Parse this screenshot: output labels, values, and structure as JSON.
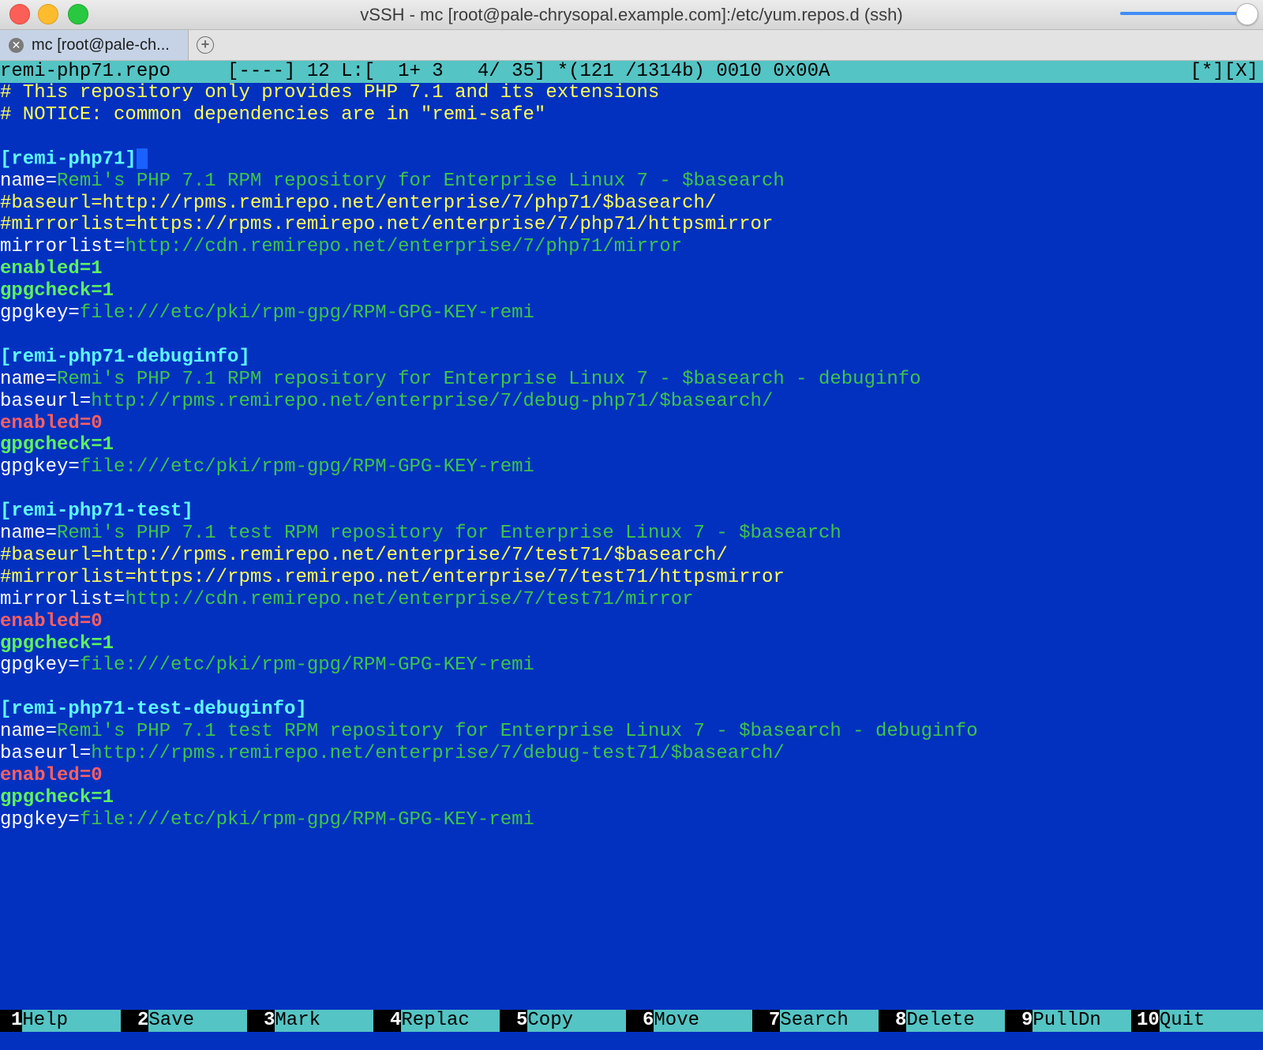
{
  "window": {
    "title": "vSSH - mc [root@pale-chrysopal.example.com]:/etc/yum.repos.d (ssh)"
  },
  "tab": {
    "label": "mc [root@pale-ch...",
    "close_glyph": "✕",
    "new_tab_glyph": "+"
  },
  "editor": {
    "status": "remi-php71.repo     [----] 12 L:[  1+ 3   4/ 35] *(121 /1314b) 0010 0x00A",
    "flags": "[*][X]",
    "lines": [
      {
        "key": "# This repository only provides PHP 7.1 and its extensions",
        "val": ""
      },
      {
        "key": "# NOTICE: common dependencies are in \"remi-safe\"",
        "val": ""
      },
      {
        "key": "",
        "val": ""
      },
      {
        "key": "[remi-php71]",
        "val": ""
      },
      {
        "key": "name=",
        "val": "Remi's PHP 7.1 RPM repository for Enterprise Linux 7 - $basearch"
      },
      {
        "key": "#baseurl=http://rpms.remirepo.net/enterprise/7/php71/$basearch/",
        "val": ""
      },
      {
        "key": "#mirrorlist=https://rpms.remirepo.net/enterprise/7/php71/httpsmirror",
        "val": ""
      },
      {
        "key": "mirrorlist=",
        "val": "http://cdn.remirepo.net/enterprise/7/php71/mirror"
      },
      {
        "key": "enabled=1",
        "val": ""
      },
      {
        "key": "gpgcheck=1",
        "val": ""
      },
      {
        "key": "gpgkey=",
        "val": "file:///etc/pki/rpm-gpg/RPM-GPG-KEY-remi"
      },
      {
        "key": "",
        "val": ""
      },
      {
        "key": "[remi-php71-debuginfo]",
        "val": ""
      },
      {
        "key": "name=",
        "val": "Remi's PHP 7.1 RPM repository for Enterprise Linux 7 - $basearch - debuginfo"
      },
      {
        "key": "baseurl=",
        "val": "http://rpms.remirepo.net/enterprise/7/debug-php71/$basearch/"
      },
      {
        "key": "enabled=0",
        "val": ""
      },
      {
        "key": "gpgcheck=1",
        "val": ""
      },
      {
        "key": "gpgkey=",
        "val": "file:///etc/pki/rpm-gpg/RPM-GPG-KEY-remi"
      },
      {
        "key": "",
        "val": ""
      },
      {
        "key": "[remi-php71-test]",
        "val": ""
      },
      {
        "key": "name=",
        "val": "Remi's PHP 7.1 test RPM repository for Enterprise Linux 7 - $basearch"
      },
      {
        "key": "#baseurl=http://rpms.remirepo.net/enterprise/7/test71/$basearch/",
        "val": ""
      },
      {
        "key": "#mirrorlist=https://rpms.remirepo.net/enterprise/7/test71/httpsmirror",
        "val": ""
      },
      {
        "key": "mirrorlist=",
        "val": "http://cdn.remirepo.net/enterprise/7/test71/mirror"
      },
      {
        "key": "enabled=0",
        "val": ""
      },
      {
        "key": "gpgcheck=1",
        "val": ""
      },
      {
        "key": "gpgkey=",
        "val": "file:///etc/pki/rpm-gpg/RPM-GPG-KEY-remi"
      },
      {
        "key": "",
        "val": ""
      },
      {
        "key": "[remi-php71-test-debuginfo]",
        "val": ""
      },
      {
        "key": "name=",
        "val": "Remi's PHP 7.1 test RPM repository for Enterprise Linux 7 - $basearch - debuginfo"
      },
      {
        "key": "baseurl=",
        "val": "http://rpms.remirepo.net/enterprise/7/debug-test71/$basearch/"
      },
      {
        "key": "enabled=0",
        "val": ""
      },
      {
        "key": "gpgcheck=1",
        "val": ""
      },
      {
        "key": "gpgkey=",
        "val": "file:///etc/pki/rpm-gpg/RPM-GPG-KEY-remi"
      }
    ]
  },
  "fkeys": [
    {
      "num": "1",
      "label": "Help"
    },
    {
      "num": "2",
      "label": "Save"
    },
    {
      "num": "3",
      "label": "Mark"
    },
    {
      "num": "4",
      "label": "Replac"
    },
    {
      "num": "5",
      "label": "Copy"
    },
    {
      "num": "6",
      "label": "Move"
    },
    {
      "num": "7",
      "label": "Search"
    },
    {
      "num": "8",
      "label": "Delete"
    },
    {
      "num": "9",
      "label": "PullDn"
    },
    {
      "num": "10",
      "label": "Quit"
    }
  ],
  "colors": {
    "terminal_bg": "#0231c0",
    "status_bg": "#55c4c4",
    "value_green": "#3ec44a",
    "comment_yellow": "#ffff55",
    "section_cyan": "#5ff7ff",
    "enabled_green": "#5ef05e",
    "disabled_red": "#ff5f5f"
  }
}
